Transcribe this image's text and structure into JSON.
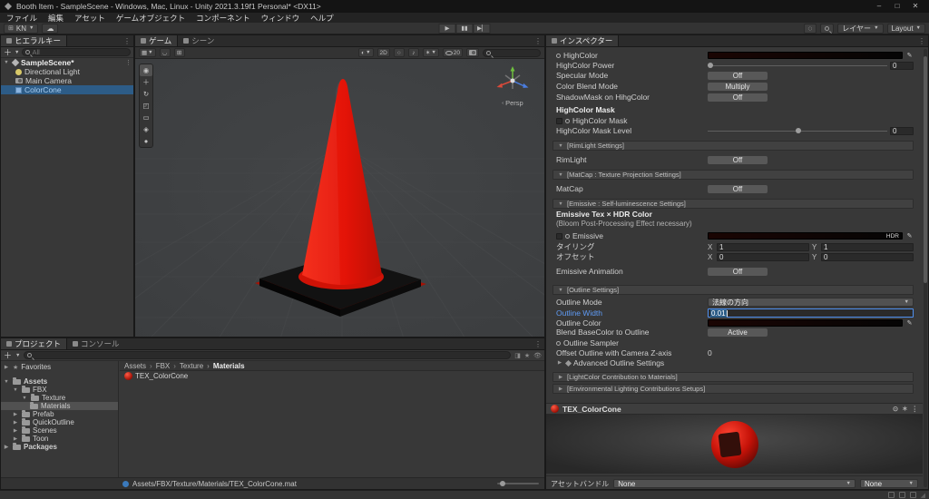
{
  "titlebar": {
    "title": "Booth Item - SampleScene - Windows, Mac, Linux - Unity 2021.3.19f1 Personal* <DX11>",
    "minimize": "–",
    "maximize": "□",
    "close": "✕"
  },
  "menubar": {
    "items": [
      "ファイル",
      "編集",
      "アセット",
      "ゲームオブジェクト",
      "コンポーネント",
      "ウィンドウ",
      "ヘルプ"
    ]
  },
  "toolbar": {
    "account": "KN",
    "layers": "レイヤー",
    "layout": "Layout",
    "play_icon": "▶",
    "pause_icon": "▮▮",
    "step_icon": "▶▏"
  },
  "hierarchy": {
    "tab": "ヒエラルキー",
    "search_placeholder": "All",
    "scene_name": "SampleScene*",
    "items": [
      {
        "label": "Directional Light"
      },
      {
        "label": "Main Camera"
      },
      {
        "label": "ColorCone"
      }
    ]
  },
  "scene": {
    "tabs": [
      {
        "label": "ゲーム"
      },
      {
        "label": "シーン"
      }
    ],
    "toolbar": {
      "two_d": "2D",
      "visibility_count": "20"
    },
    "persp": "Persp"
  },
  "project": {
    "tabs": [
      {
        "label": "プロジェクト"
      },
      {
        "label": "コンソール"
      }
    ],
    "tree": [
      {
        "label": "Favorites"
      },
      {
        "label": "Assets"
      },
      {
        "label": "FBX"
      },
      {
        "label": "Texture"
      },
      {
        "label": "Materials"
      },
      {
        "label": "Prefab"
      },
      {
        "label": "QuickOutline"
      },
      {
        "label": "Scenes"
      },
      {
        "label": "Toon"
      },
      {
        "label": "Packages"
      }
    ],
    "breadcrumb": [
      {
        "label": "Assets"
      },
      {
        "label": "FBX"
      },
      {
        "label": "Texture"
      },
      {
        "label": "Materials"
      }
    ],
    "item": "TEX_ColorCone",
    "path": "Assets/FBX/Texture/Materials/TEX_ColorCone.mat"
  },
  "inspector": {
    "tab": "インスペクター",
    "highcolor": {
      "color_label": "HighColor",
      "power_label": "HighColor Power",
      "power_value": "0",
      "specular_label": "Specular Mode",
      "specular_value": "Off",
      "blend_label": "Color Blend Mode",
      "blend_value": "Multiply",
      "shadowmask_label": "ShadowMask on HihgColor",
      "shadowmask_value": "Off",
      "mask_header": "HighColor Mask",
      "mask_label": "HighColor Mask",
      "level_label": "HighColor Mask Level",
      "level_value": "0"
    },
    "rimlight": {
      "header": "[RimLight Settings]",
      "label": "RimLight",
      "value": "Off"
    },
    "matcap": {
      "header": "[MatCap : Texture Projection Settings]",
      "label": "MatCap",
      "value": "Off"
    },
    "emissive": {
      "header": "[Emissive : Self-luminescence Settings]",
      "title": "Emissive Tex × HDR Color",
      "subtitle": "(Bloom Post-Processing Effect necessary)",
      "toggle_label": "Emissive",
      "hdr_badge": "HDR",
      "tiling_label": "タイリング",
      "offset_label": "オフセット",
      "x_label": "X",
      "y_label": "Y",
      "tiling_x": "1",
      "tiling_y": "1",
      "offset_x": "0",
      "offset_y": "0",
      "anim_label": "Emissive Animation",
      "anim_value": "Off"
    },
    "outline": {
      "header": "[Outline Settings]",
      "mode_label": "Outline Mode",
      "mode_value": "法線の方向",
      "width_label": "Outline Width",
      "width_value": "0.01",
      "color_label": "Outline Color",
      "blend_label": "Blend BaseColor to Outline",
      "blend_value": "Active",
      "sampler_label": "Outline Sampler",
      "zoffset_label": "Offset Outline with Camera Z-axis",
      "zoffset_value": "0",
      "advanced_label": "Advanced Outline Settings"
    },
    "lightcolor_header": "[LightColor Contribution to Materials]",
    "environment_header": "[Environmental Lighting Contributions Setups]",
    "material_name": "TEX_ColorCone",
    "asset_bundle": {
      "label": "アセットバンドル",
      "value1": "None",
      "value2": "None"
    }
  },
  "colors": {
    "cone_red": "#e81505",
    "selection_blue": "#2d5c87",
    "focus_blue": "#4f90f0"
  }
}
